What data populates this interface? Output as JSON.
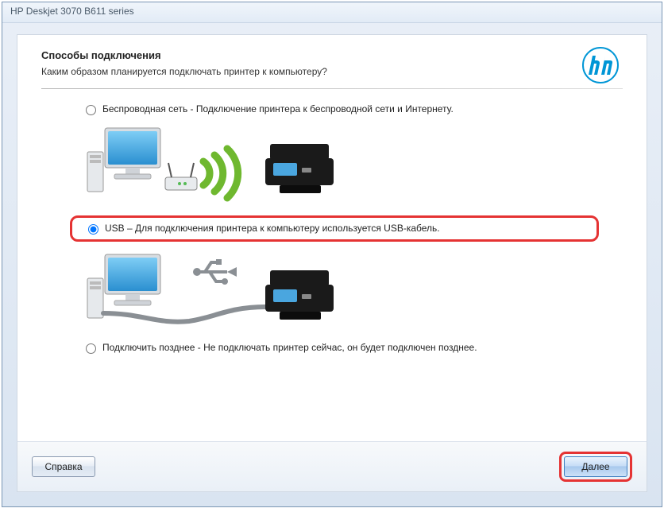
{
  "window": {
    "title": "HP Deskjet 3070 B611 series"
  },
  "header": {
    "title": "Способы подключения",
    "subtitle": "Каким образом планируется подключать принтер к компьютеру?"
  },
  "logo": {
    "name": "hp-logo"
  },
  "options": {
    "wireless": {
      "label": "Беспроводная сеть - Подключение принтера к беспроводной сети и Интернету.",
      "selected": false
    },
    "usb": {
      "label": "USB – Для подключения принтера к компьютеру используется USB-кабель.",
      "selected": true
    },
    "later": {
      "label": "Подключить позднее - Не подключать принтер сейчас, он будет подключен  позднее.",
      "selected": false
    }
  },
  "footer": {
    "help": "Справка",
    "next": "Далее"
  }
}
